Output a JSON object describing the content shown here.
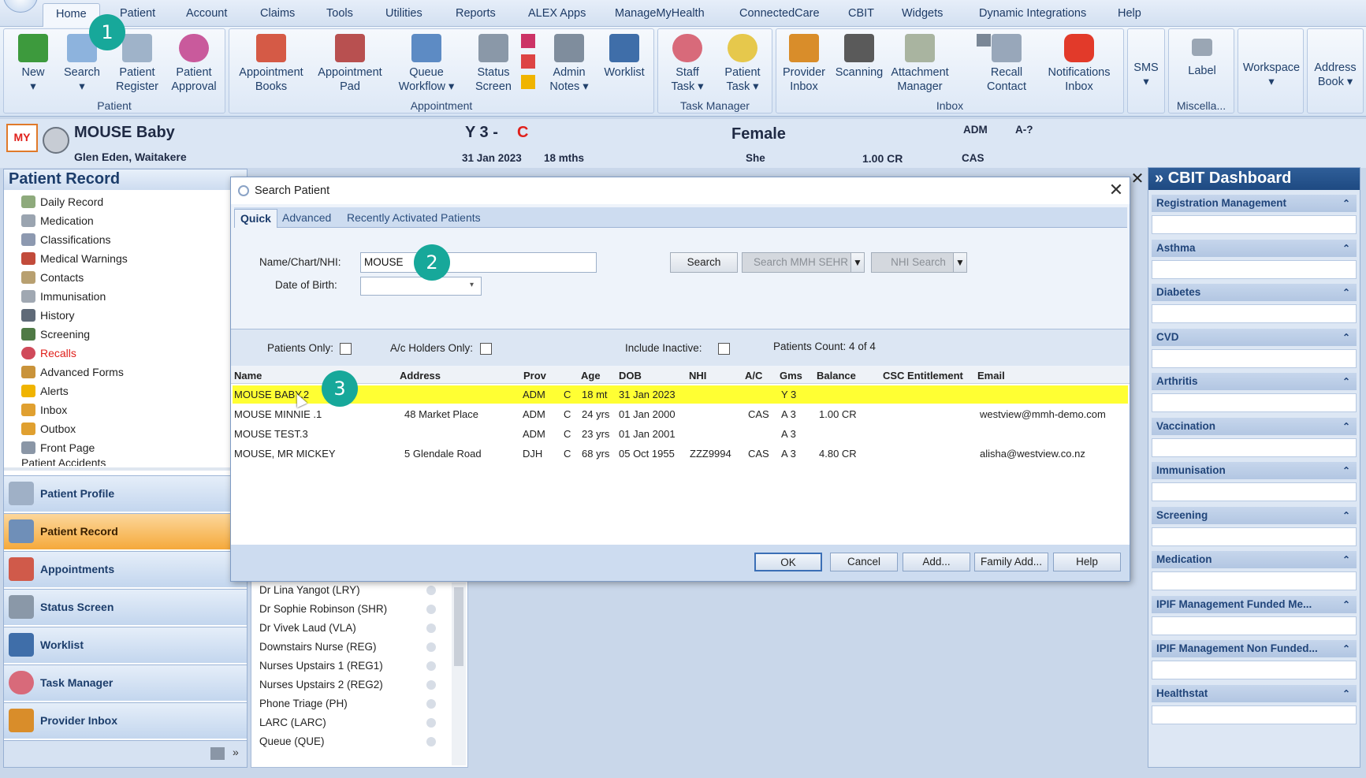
{
  "menu": {
    "tabs": [
      "Home",
      "Patient",
      "Account",
      "Claims",
      "Tools",
      "Utilities",
      "Reports",
      "ALEX Apps",
      "ManageMyHealth",
      "ConnectedCare",
      "CBIT",
      "Widgets",
      "Dynamic Integrations",
      "Help"
    ],
    "active": "Home"
  },
  "ribbon": {
    "groups": {
      "patient": "Patient",
      "appointment": "Appointment",
      "task_manager": "Task Manager",
      "inbox": "Inbox",
      "misc": "Miscella..."
    },
    "buttons": {
      "new": "New\n▾",
      "search": "Search\n▾",
      "patient_register": "Patient\nRegister",
      "patient_approval": "Patient\nApproval",
      "appointment_books": "Appointment\nBooks",
      "appointment_pad": "Appointment\nPad",
      "queue_workflow": "Queue\nWorkflow ▾",
      "status_screen": "Status\nScreen",
      "admin_notes": "Admin\nNotes ▾",
      "worklist": "Worklist",
      "staff_task": "Staff\nTask ▾",
      "patient_task": "Patient\nTask ▾",
      "provider_inbox": "Provider\nInbox",
      "scanning": "Scanning",
      "attachment_manager": "Attachment\nManager",
      "recall_contact": "Recall\nContact",
      "notifications_inbox": "Notifications\nInbox",
      "sms": "SMS\n▾",
      "label": "Label",
      "workspace": "Workspace\n▾",
      "address_book": "Address\nBook ▾"
    }
  },
  "banner": {
    "logo": "MY",
    "name": "MOUSE Baby",
    "location": "Glen Eden, Waitakere",
    "code_main": "Y 3 -",
    "code_flag": "C",
    "dob": "31 Jan 2023",
    "age": "18 mths",
    "gender": "Female",
    "pronoun": "She",
    "balance": "1.00 CR",
    "adm": "ADM",
    "a_code": "A-?",
    "cas": "CAS"
  },
  "left_panel": {
    "title": "Patient Record",
    "tree": [
      "Daily Record",
      "Medication",
      "Classifications",
      "Medical Warnings",
      "Contacts",
      "Immunisation",
      "History",
      "Screening",
      "Recalls",
      "Advanced Forms",
      "Alerts",
      "Inbox",
      "Outbox",
      "Front Page",
      "Patient Accidents"
    ],
    "nav": [
      "Patient Profile",
      "Patient Record",
      "Appointments",
      "Status Screen",
      "Worklist",
      "Task Manager",
      "Provider Inbox"
    ],
    "nav_active": "Patient Record",
    "expand_glyph": "»"
  },
  "bg_list": [
    "Dr Lina Yangot (LRY)",
    "Dr Sophie Robinson (SHR)",
    "Dr Vivek Laud (VLA)",
    "Downstairs Nurse (REG)",
    "Nurses Upstairs 1 (REG1)",
    "Nurses Upstairs 2 (REG2)",
    "Phone Triage (PH)",
    "LARC  (LARC)",
    "Queue (QUE)"
  ],
  "dashboard": {
    "title": "CBIT Dashboard",
    "sections": [
      "Registration Management",
      "Asthma",
      "Diabetes",
      "CVD",
      "Arthritis",
      "Vaccination",
      "Immunisation",
      "Screening",
      "Medication",
      "IPIF Management Funded Me...",
      "IPIF Management Non Funded...",
      "Healthstat"
    ]
  },
  "dialog": {
    "title": "Search Patient",
    "tabs": [
      "Quick",
      "Advanced",
      "Recently Activated Patients"
    ],
    "name_label": "Name/Chart/NHI:",
    "name_value": "MOUSE",
    "dob_label": "Date of Birth:",
    "search_btn": "Search",
    "mmh_btn": "Search MMH SEHR",
    "nhi_btn": "NHI Search",
    "patients_only": "Patients Only:",
    "ac_holders_only": "A/c Holders Only:",
    "include_inactive": "Include Inactive:",
    "patients_count": "Patients Count: 4 of 4",
    "columns": [
      "Name",
      "Address",
      "Prov",
      "Age",
      "DOB",
      "NHI",
      "A/C",
      "Gms",
      "Balance",
      "CSC Entitlement",
      "Email"
    ],
    "rows": [
      {
        "name": "MOUSE BABY.2",
        "address": "",
        "prov": "ADM",
        "flag": "C",
        "age": "18 mt",
        "dob": "31 Jan 2023",
        "nhi": "",
        "ac": "",
        "gms": "Y 3",
        "balance": "",
        "csc": "",
        "email": ""
      },
      {
        "name": "MOUSE MINNIE .1",
        "address": "48 Market Place",
        "prov": "ADM",
        "flag": "C",
        "age": "24 yrs",
        "dob": "01 Jan 2000",
        "nhi": "",
        "ac": "CAS",
        "gms": "A 3",
        "balance": "1.00 CR",
        "csc": "",
        "email": "westview@mmh-demo.com"
      },
      {
        "name": "MOUSE TEST.3",
        "address": "",
        "prov": "ADM",
        "flag": "C",
        "age": "23 yrs",
        "dob": "01 Jan 2001",
        "nhi": "",
        "ac": "",
        "gms": "A 3",
        "balance": "",
        "csc": "",
        "email": ""
      },
      {
        "name": "MOUSE, MR MICKEY",
        "address": "5 Glendale Road",
        "prov": "DJH",
        "flag": "C",
        "age": "68 yrs",
        "dob": "05 Oct 1955",
        "nhi": "ZZZ9994",
        "ac": "CAS",
        "gms": "A 3",
        "balance": "4.80 CR",
        "csc": "",
        "email": "alisha@westview.co.nz"
      }
    ],
    "ok": "OK",
    "cancel": "Cancel",
    "add": "Add...",
    "family_add": "Family Add...",
    "help": "Help",
    "close_glyph": "✕"
  },
  "callouts": [
    "1",
    "2",
    "3"
  ],
  "outer_close": "✕",
  "colors": {
    "accent": "#17a89a",
    "selection": "#ffff33",
    "active_nav": "#f5a93b",
    "flag_red": "#e0201b"
  }
}
